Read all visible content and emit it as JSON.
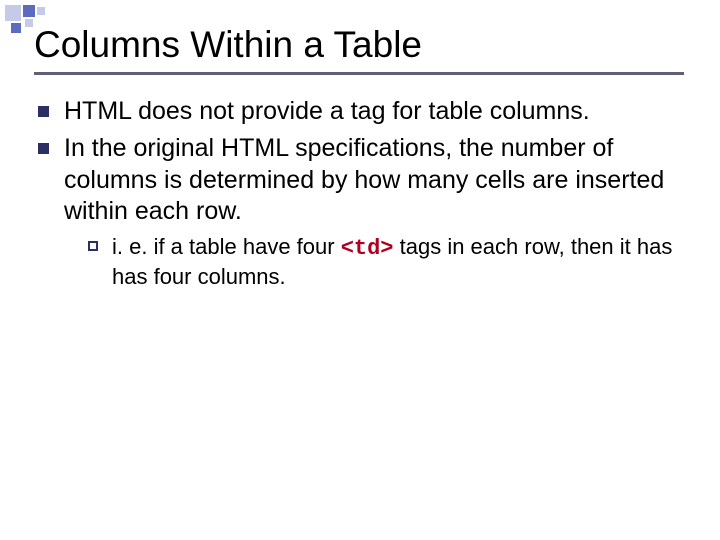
{
  "title": "Columns Within a Table",
  "bullets": {
    "b1": "HTML does not provide a tag for table columns.",
    "b2": "In the original HTML specifications, the number of columns is determined by how many cells are inserted within each row.",
    "sub1_pre": "i. e.  if a table have four ",
    "sub1_code": "<td>",
    "sub1_post": " tags in each row, then it has has four columns."
  }
}
